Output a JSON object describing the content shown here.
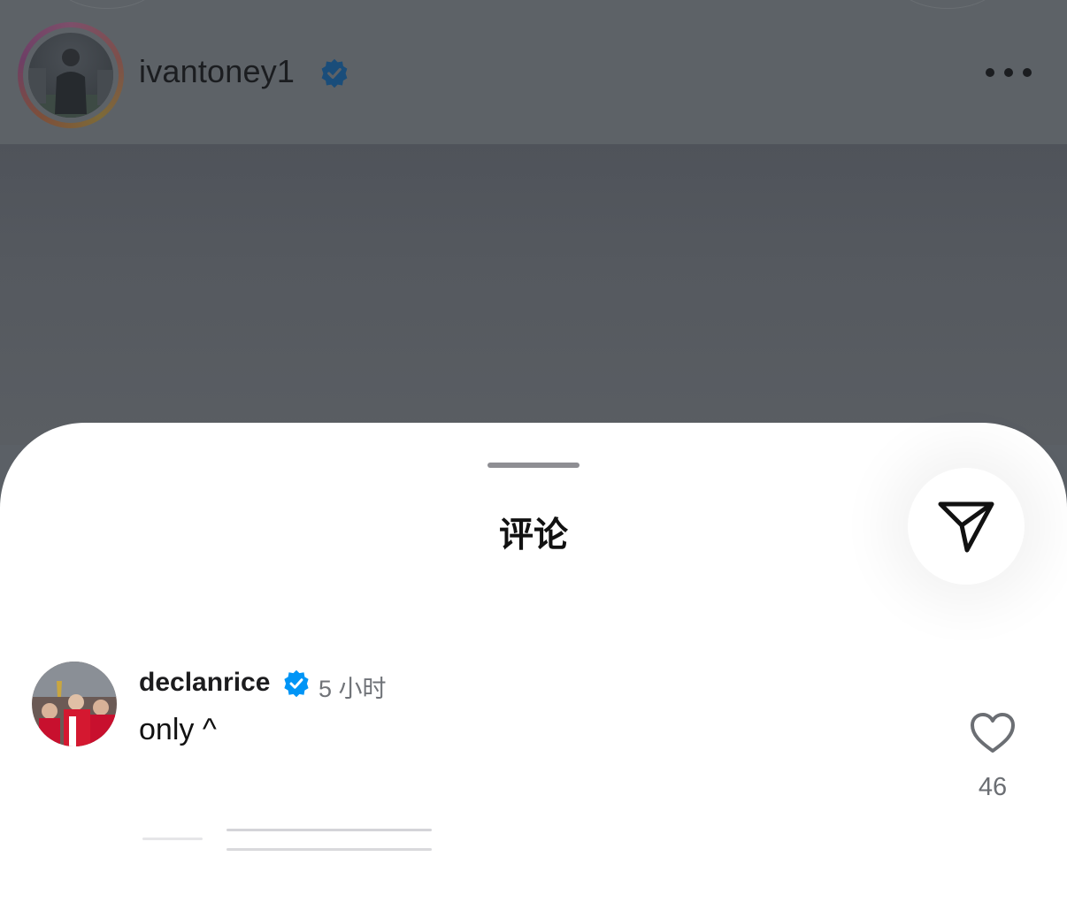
{
  "post": {
    "username": "ivantoney1",
    "verified": true,
    "more_icon": "more-horizontal-icon"
  },
  "sheet": {
    "title": "评论",
    "share_icon": "share-send-icon"
  },
  "comments": [
    {
      "username": "declanrice",
      "verified": true,
      "time": "5 小时",
      "text": "only ^",
      "likes": "46",
      "like_icon": "heart-outline-icon"
    }
  ],
  "colors": {
    "verified_blue": "#0095f6",
    "sheet_bg": "#ffffff",
    "dim_overlay": "#5b6066"
  }
}
